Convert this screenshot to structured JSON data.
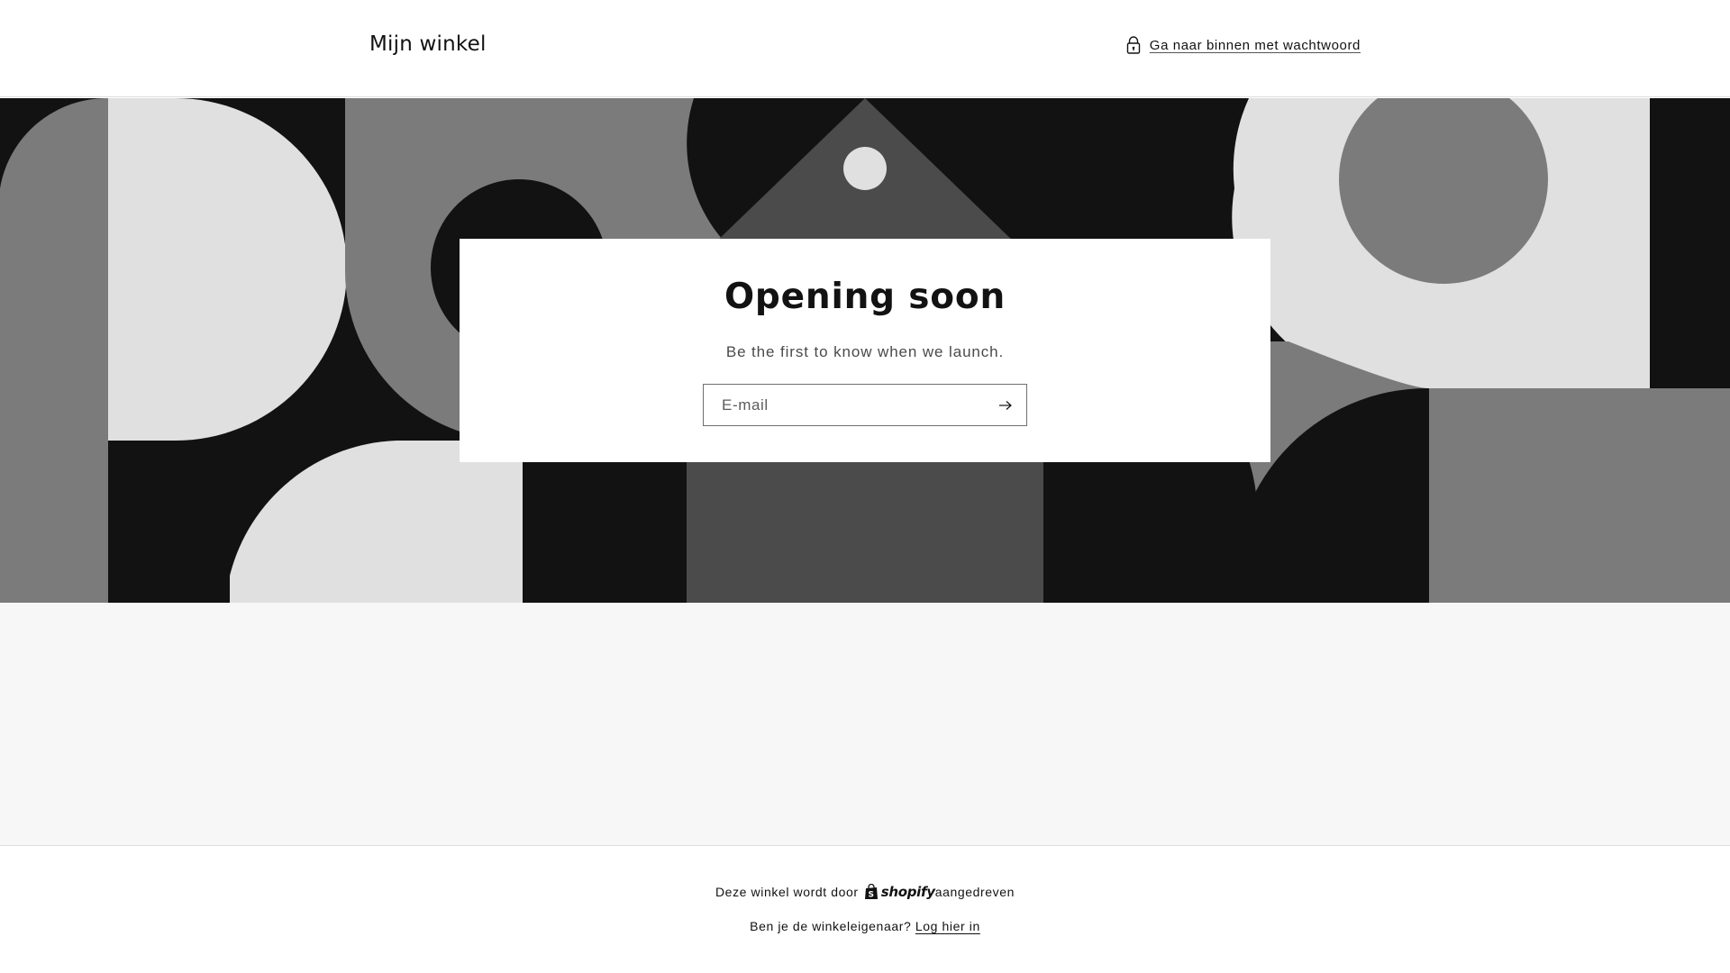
{
  "header": {
    "store_name": "Mijn winkel",
    "password_link_label": "Ga naar binnen met wachtwoord",
    "password_icon": "lock-icon"
  },
  "banner": {
    "style": "geometric-grayscale-pattern",
    "colors": {
      "black": "#121212",
      "dark_gray": "#4b4b4b",
      "mid_gray": "#7b7b7b",
      "light_gray": "#e0e0e0"
    }
  },
  "newsletter": {
    "title": "Opening soon",
    "subtitle": "Be the first to know when we launch.",
    "email_placeholder": "E-mail",
    "email_value": "",
    "submit_icon": "arrow-right-icon"
  },
  "footer": {
    "powered_prefix": "Deze winkel wordt door",
    "shopify_wordmark": "shopify",
    "powered_suffix": "aangedreven",
    "owner_question": "Ben je de winkeleigenaar?",
    "login_label": "Log hier in"
  },
  "colors": {
    "text": "#121212",
    "page_background": "#ffffff",
    "footer_band": "#f7f7f7",
    "border": "#dedede"
  }
}
